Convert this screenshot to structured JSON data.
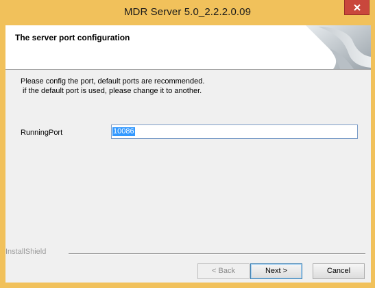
{
  "window": {
    "title": "MDR Server 5.0_2.2.2.0.09",
    "close_icon": "close-icon",
    "frame_color": "#f1c15b",
    "close_color": "#c9473c"
  },
  "header": {
    "title": "The server port configuration",
    "graphic": "page-curl-graphic"
  },
  "content": {
    "description_line1": "Please config the port, default ports are recommended.",
    "description_line2": " if the default port is used, please change it to another.",
    "port_label": "RunningPort",
    "port_value": "10086"
  },
  "footer": {
    "brand_label": "InstallShield",
    "back_label": "< Back",
    "next_label": "Next >",
    "cancel_label": "Cancel"
  }
}
